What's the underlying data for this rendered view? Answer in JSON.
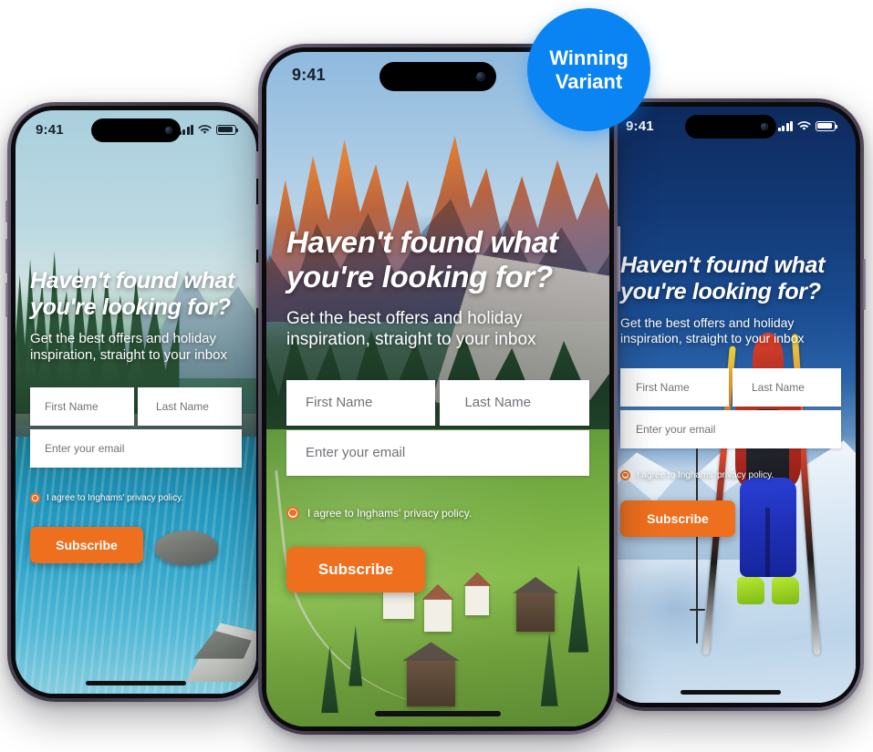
{
  "badge": {
    "line1": "Winning",
    "line2": "Variant",
    "color": "#0b84f3"
  },
  "colors": {
    "accent_orange": "#ee6f1d",
    "badge_blue": "#0b84f3",
    "field_white": "#ffffff",
    "placeholder_gray": "#6f7277",
    "frame_titanium": "#4b4452"
  },
  "status_bar": {
    "time": "9:41",
    "signal_icon": "cellular-signal-icon",
    "wifi_icon": "wifi-icon",
    "battery_icon": "battery-icon"
  },
  "form": {
    "headline": "Haven't found what you're looking for?",
    "headline_line1": "Haven't found what",
    "headline_line2": "you're looking for?",
    "subhead": "Get the best offers and holiday inspiration, straight to your inbox",
    "subhead_line1": "Get the best offers and holiday",
    "subhead_line2": "inspiration, straight to your inbox",
    "first_name_placeholder": "First Name",
    "last_name_placeholder": "Last Name",
    "email_placeholder": "Enter your email",
    "consent_label": "I agree to Inghams' privacy policy.",
    "submit_label": "Subscribe"
  },
  "variants": [
    {
      "id": "variant-a",
      "position": "left",
      "scene": "alpine-lake-with-pine-forest",
      "status_bar_color": "#15242b",
      "has_wifi": true,
      "has_battery": true
    },
    {
      "id": "variant-b",
      "position": "center",
      "scene": "dolomites-sunrise-over-green-valley",
      "status_bar_color": "#132033",
      "has_wifi": false,
      "has_battery": false,
      "winning": true
    },
    {
      "id": "variant-c",
      "position": "right",
      "scene": "ski-tourer-on-snowy-ridge",
      "status_bar_color": "#ffffff",
      "has_wifi": true,
      "has_battery": true
    }
  ]
}
